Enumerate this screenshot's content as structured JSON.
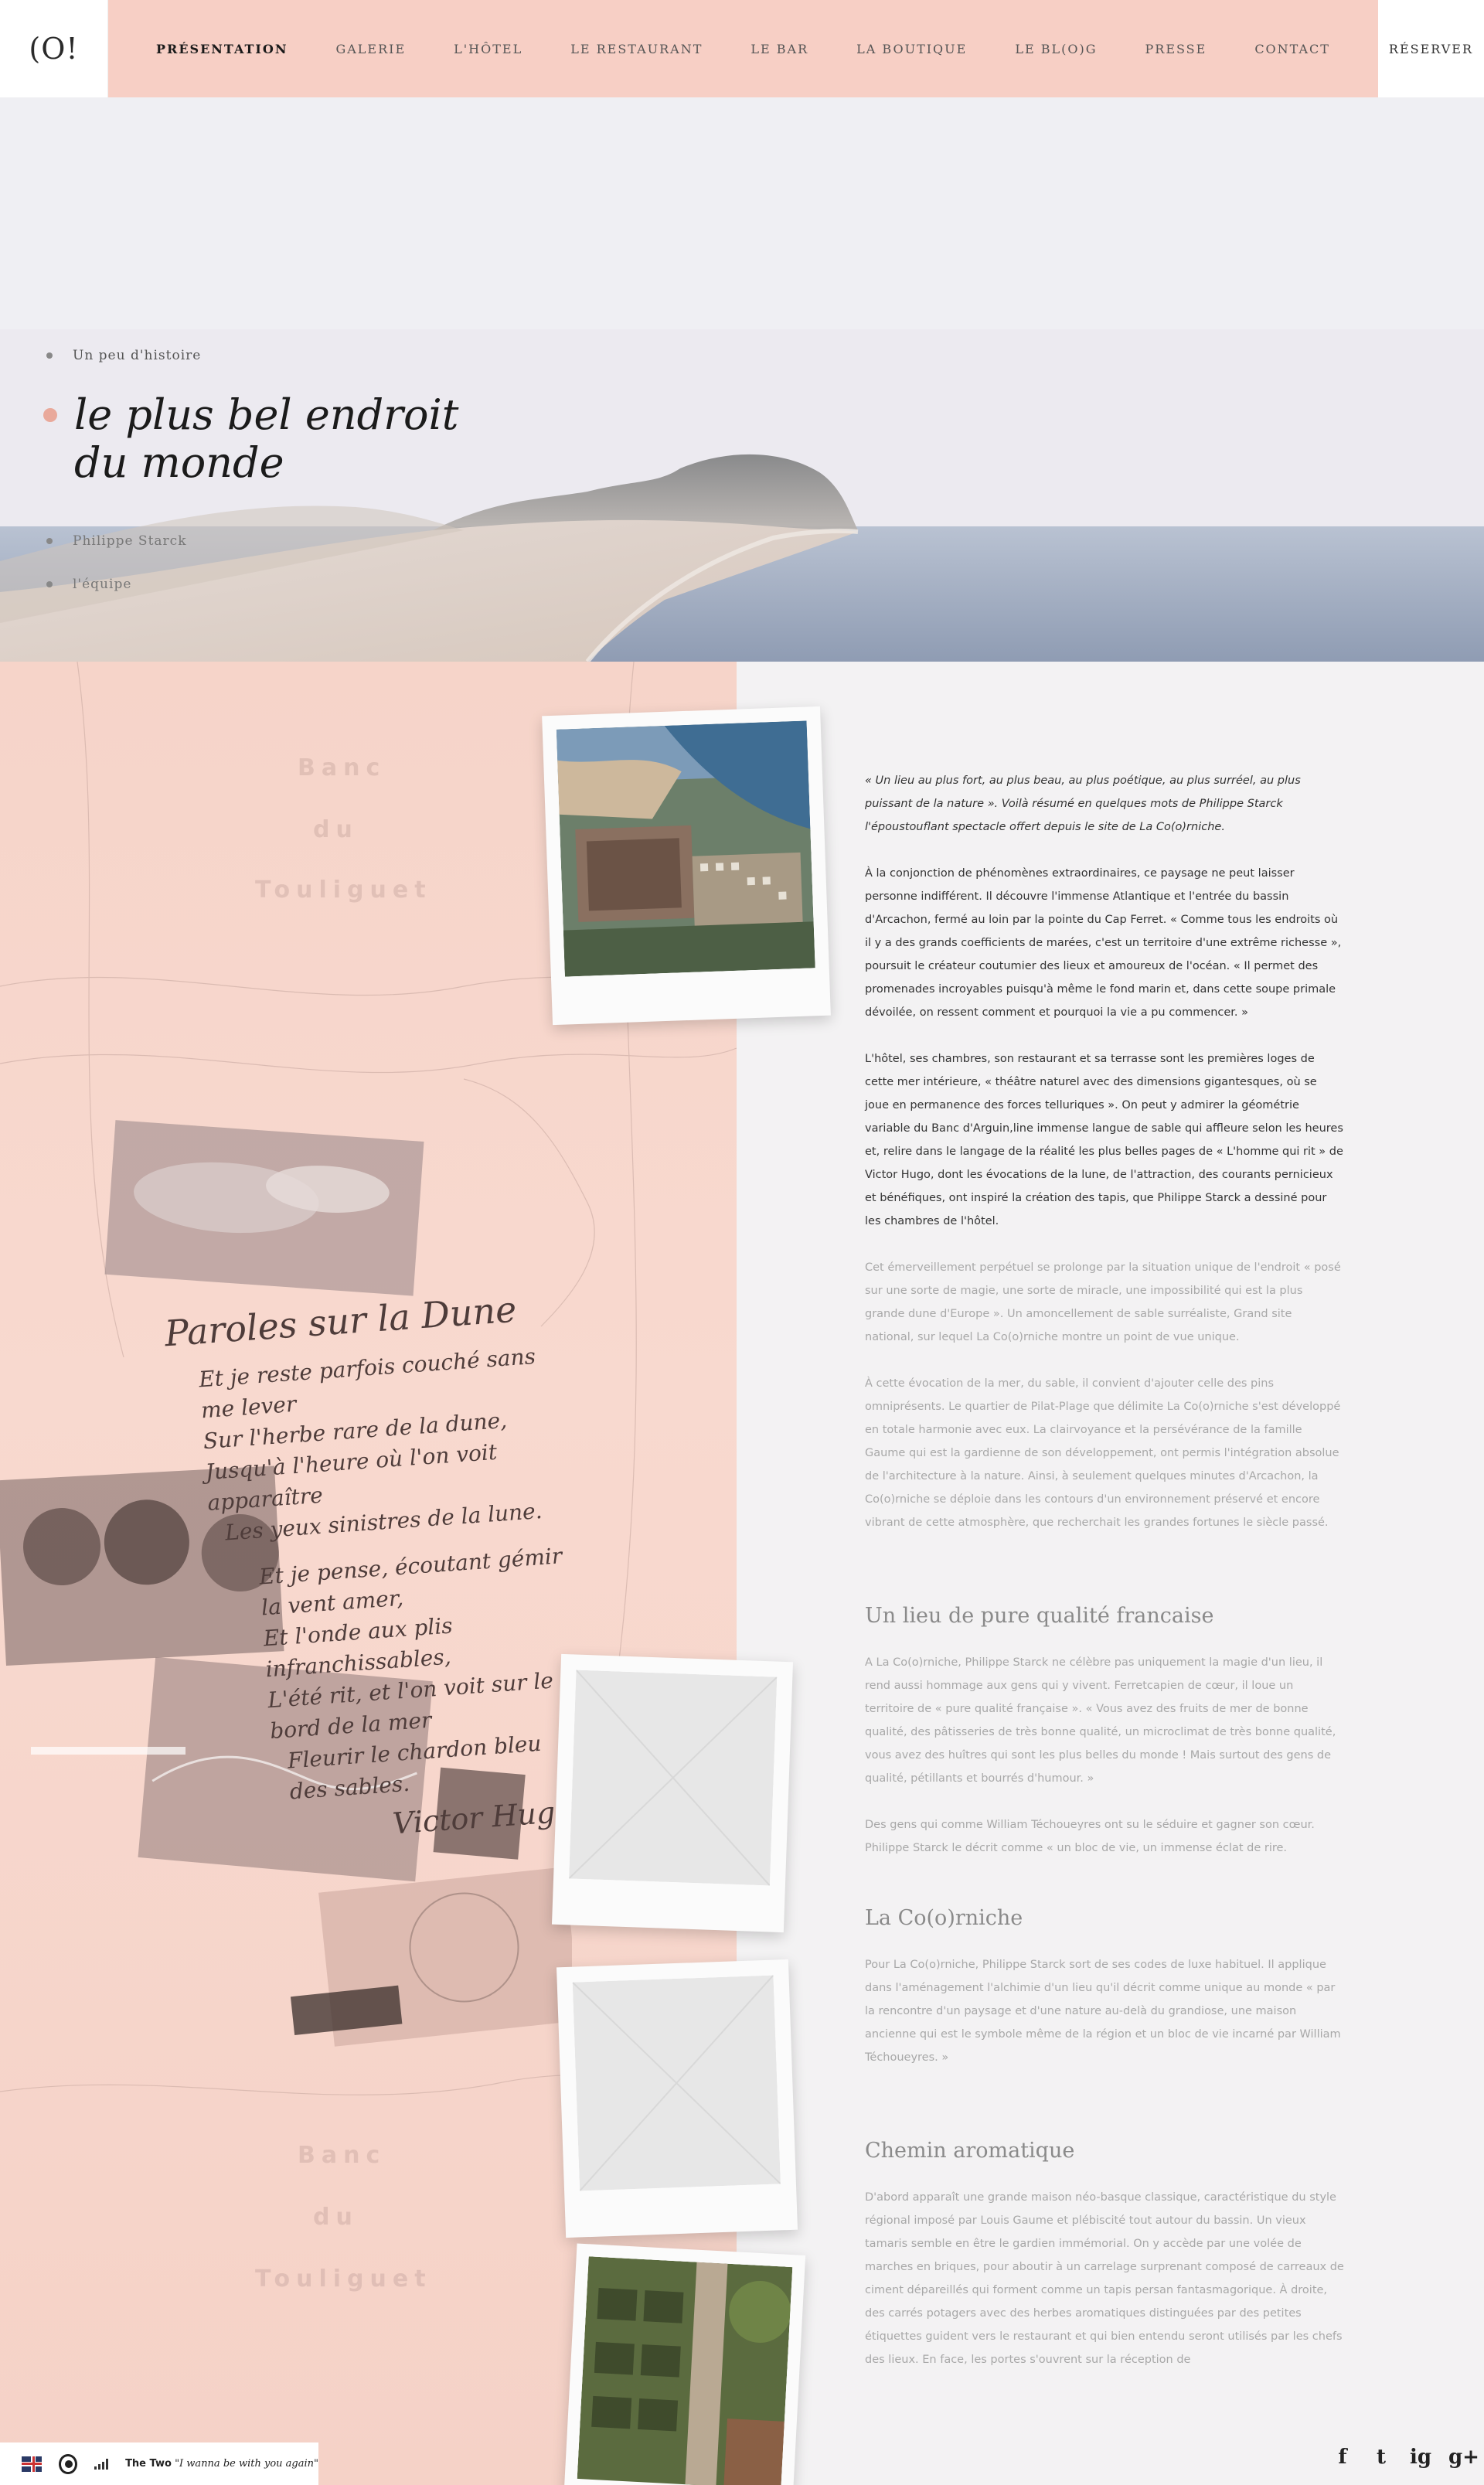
{
  "header": {
    "logo": "(O!",
    "nav": [
      "PRÉSENTATION",
      "GALERIE",
      "L'HÔTEL",
      "LE RESTAURANT",
      "LE BAR",
      "LA BOUTIQUE",
      "LE BL(O)G",
      "PRESSE",
      "CONTACT"
    ],
    "active_nav": "PRÉSENTATION",
    "reserve": "RÉSERVER"
  },
  "side_menu": {
    "items": [
      {
        "label": "Un peu d'histoire"
      },
      {
        "label": "le plus bel endroit du monde"
      },
      {
        "label": "Philippe Starck"
      },
      {
        "label": "l'équipe"
      }
    ]
  },
  "collage": {
    "map_words": [
      "Banc",
      "du",
      "Touliguet",
      "Banc",
      "du",
      "Touliguet"
    ],
    "poem_title": "Paroles sur la Dune",
    "poem_lines": [
      "Et je reste parfois couché sans me lever",
      "Sur l'herbe rare de la dune,",
      "Jusqu'à l'heure où l'on voit apparaître",
      "Les yeux sinistres de la lune.",
      "Et je pense, écoutant gémir la vent amer,",
      "Et l'onde aux plis infranchissables,",
      "L'été rit, et l'on voit sur le bord de la mer",
      "Fleurir le chardon bleu des sables.",
      "Victor Hugo"
    ]
  },
  "content": {
    "paragraphs": [
      {
        "text": "« Un lieu au plus fort, au plus beau, au plus poétique, au plus surréel, au plus puissant de la nature ». Voilà résumé en quelques mots de Philippe Starck l'époustouflant spectacle offert depuis le site de La Co(o)rniche.",
        "tone": "dark"
      },
      {
        "text": "À la conjonction de phénomènes extraordinaires, ce paysage ne peut laisser personne indifférent. Il découvre l'immense Atlantique et l'entrée du bassin d'Arcachon, fermé au loin par la pointe du Cap Ferret. « Comme tous les endroits où il y a des grands coefficients de marées, c'est un territoire d'une extrême richesse », poursuit le créateur coutumier des lieux et amoureux de l'océan. « Il permet des promenades incroyables puisqu'à même le fond marin et, dans cette soupe primale dévoilée, on ressent comment et pourquoi la vie a pu commencer. »",
        "tone": "dark"
      },
      {
        "text": "L'hôtel, ses chambres, son restaurant et sa terrasse sont les premières loges de cette mer intérieure, « théâtre naturel avec des dimensions gigantesques, où se joue en permanence des forces telluriques ». On peut y admirer la géométrie variable du Banc d'Arguin,line immense langue de sable qui affleure selon les heures et, relire dans le langage de la réalité les plus belles pages de « L'homme qui rit » de Victor Hugo, dont les évocations de la lune, de l'attraction, des courants pernicieux et bénéfiques, ont inspiré la création des tapis, que Philippe Starck a dessiné pour les chambres de l'hôtel.",
        "tone": "dark"
      },
      {
        "text": "Cet émerveillement perpétuel se prolonge par la situation unique de l'endroit « posé sur une sorte de magie, une sorte de miracle, une impossibilité qui est la plus grande dune d'Europe ». Un amoncellement de sable surréaliste, Grand site national, sur lequel La Co(o)rniche montre un point de vue unique.",
        "tone": "light"
      },
      {
        "text": "À cette évocation de la mer, du sable, il convient d'ajouter celle des pins omniprésents. Le quartier de Pilat-Plage que délimite La Co(o)rniche s'est développé en totale harmonie avec eux. La clairvoyance et la persévérance de la famille Gaume qui est la gardienne de son développement, ont permis l'intégration absolue de l'architecture à la nature. Ainsi, à seulement quelques minutes d'Arcachon, la Co(o)rniche se déploie dans les contours d'un environnement préservé et encore vibrant de cette atmosphère, que recherchait les grandes fortunes le siècle passé.",
        "tone": "light"
      }
    ],
    "sections": [
      {
        "title": "Un lieu de pure qualité francaise",
        "paragraphs": [
          "A La Co(o)rniche, Philippe Starck ne célèbre pas uniquement la magie d'un lieu, il rend aussi hommage aux gens qui y vivent. Ferretcapien de cœur, il loue un territoire de « pure qualité française ». « Vous avez des fruits de mer de bonne qualité, des pâtisseries de très bonne qualité, un microclimat de très bonne qualité, vous avez des huîtres qui sont les plus belles du monde ! Mais surtout des gens de qualité, pétillants et bourrés d'humour. »",
          "Des gens qui comme William Téchoueyres ont su le séduire et gagner son cœur. Philippe Starck le décrit comme « un bloc de vie, un immense éclat de rire."
        ]
      },
      {
        "title": "La Co(o)rniche",
        "paragraphs": [
          "Pour La Co(o)rniche, Philippe Starck sort de ses codes de luxe habituel. Il applique dans l'aménagement l'alchimie d'un lieu qu'il décrit comme unique au monde « par la rencontre d'un paysage et d'une nature au-delà du grandiose, une maison ancienne qui est le symbole même de la région et un bloc de vie incarné par William Téchoueyres. »"
        ]
      },
      {
        "title": "Chemin aromatique",
        "paragraphs": [
          "D'abord apparaît une grande maison néo-basque classique, caractéristique du style régional imposé par Louis Gaume et plébiscité tout autour du bassin. Un vieux tamaris semble en être le gardien immémorial. On y accède par une volée de marches en briques, pour aboutir à un carrelage surprenant composé de carreaux de ciment dépareillés qui forment comme un tapis persan fantasmagorique. À droite, des carrés potagers avec des herbes aromatiques distinguées par des petites étiquettes guident vers le restaurant et qui bien entendu seront utilisés par les chefs des lieux. En face, les portes s'ouvrent sur la réception de"
        ]
      }
    ]
  },
  "footer": {
    "track_artist": "The Two",
    "track_title": "\"I wanna be with you again\"",
    "social": [
      "f",
      "t",
      "ig",
      "g+"
    ]
  },
  "colors": {
    "nav_bg": "#f7cfc5",
    "pink_panel": "#f6d4c9",
    "right_panel": "#f3f2f3",
    "accent_dot": "#e9a99b"
  }
}
